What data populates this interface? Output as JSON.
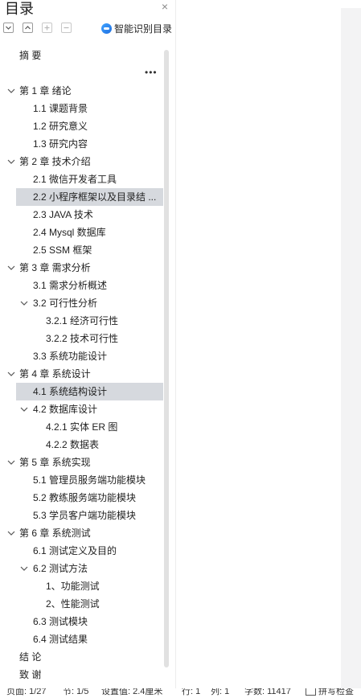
{
  "panel": {
    "title": "目录",
    "close_symbol": "×",
    "toolbar": {
      "collapse_icon": "collapse-all-icon",
      "expand_icon": "expand-all-icon",
      "add_icon": "add-heading-icon",
      "remove_icon": "remove-heading-icon",
      "smart_label": "智能识别目录"
    },
    "more_label": "•••"
  },
  "toc": [
    {
      "label": "摘  要",
      "level": 0,
      "expanded": null,
      "selected": false
    },
    {
      "label": "第 1 章  绪论",
      "level": 0,
      "expanded": true,
      "selected": false
    },
    {
      "label": "1.1 课题背景",
      "level": 1,
      "expanded": null,
      "selected": false
    },
    {
      "label": "1.2 研究意义",
      "level": 1,
      "expanded": null,
      "selected": false
    },
    {
      "label": "1.3 研究内容",
      "level": 1,
      "expanded": null,
      "selected": false
    },
    {
      "label": "第 2 章  技术介绍",
      "level": 0,
      "expanded": true,
      "selected": false
    },
    {
      "label": "2.1 微信开发者工具",
      "level": 1,
      "expanded": null,
      "selected": false
    },
    {
      "label": "2.2 小程序框架以及目录结 ...",
      "level": 1,
      "expanded": null,
      "selected": true
    },
    {
      "label": "2.3 JAVA 技术",
      "level": 1,
      "expanded": null,
      "selected": false
    },
    {
      "label": "2.4    Mysql 数据库",
      "level": 1,
      "expanded": null,
      "selected": false
    },
    {
      "label": "2.5 SSM 框架",
      "level": 1,
      "expanded": null,
      "selected": false
    },
    {
      "label": "第 3 章  需求分析",
      "level": 0,
      "expanded": true,
      "selected": false
    },
    {
      "label": "3.1 需求分析概述",
      "level": 1,
      "expanded": null,
      "selected": false
    },
    {
      "label": "3.2 可行性分析",
      "level": 1,
      "expanded": true,
      "selected": false
    },
    {
      "label": "3.2.1 经济可行性",
      "level": 2,
      "expanded": null,
      "selected": false
    },
    {
      "label": "3.2.2 技术可行性",
      "level": 2,
      "expanded": null,
      "selected": false
    },
    {
      "label": "3.3 系统功能设计",
      "level": 1,
      "expanded": null,
      "selected": false
    },
    {
      "label": "第 4 章  系统设计",
      "level": 0,
      "expanded": true,
      "selected": false
    },
    {
      "label": "4.1 系统结构设计",
      "level": 1,
      "expanded": null,
      "selected": true
    },
    {
      "label": "4.2 数据库设计",
      "level": 1,
      "expanded": true,
      "selected": false
    },
    {
      "label": "4.2.1 实体 ER 图",
      "level": 2,
      "expanded": null,
      "selected": false
    },
    {
      "label": "4.2.2 数据表",
      "level": 2,
      "expanded": null,
      "selected": false
    },
    {
      "label": "第 5 章  系统实现",
      "level": 0,
      "expanded": true,
      "selected": false
    },
    {
      "label": "5.1 管理员服务端功能模块",
      "level": 1,
      "expanded": null,
      "selected": false
    },
    {
      "label": "5.2 教练服务端功能模块",
      "level": 1,
      "expanded": null,
      "selected": false
    },
    {
      "label": "5.3 学员客户端功能模块",
      "level": 1,
      "expanded": null,
      "selected": false
    },
    {
      "label": "第 6 章  系统测试",
      "level": 0,
      "expanded": true,
      "selected": false
    },
    {
      "label": "6.1 测试定义及目的",
      "level": 1,
      "expanded": null,
      "selected": false
    },
    {
      "label": "6.2 测试方法",
      "level": 1,
      "expanded": true,
      "selected": false
    },
    {
      "label": "1、功能测试",
      "level": 2,
      "expanded": null,
      "selected": false
    },
    {
      "label": "2、性能测试",
      "level": 2,
      "expanded": null,
      "selected": false
    },
    {
      "label": "6.3 测试模块",
      "level": 1,
      "expanded": null,
      "selected": false
    },
    {
      "label": "6.4 测试结果",
      "level": 1,
      "expanded": null,
      "selected": false
    },
    {
      "label": "结  论",
      "level": 0,
      "expanded": null,
      "selected": false
    },
    {
      "label": "致  谢",
      "level": 0,
      "expanded": null,
      "selected": false
    }
  ],
  "status_bar": {
    "page": "页面: 1/27",
    "section": "节: 1/5",
    "position": "设置值: 2.4厘米",
    "row": "行: 1",
    "column": "列: 1",
    "word_count": "字数: 11417",
    "spell_check": "拼写检查"
  },
  "colors": {
    "selected_bg": "#d6d9de",
    "scroll_thumb": "#e1e1e1",
    "smart_icon": "#2f86f0"
  }
}
